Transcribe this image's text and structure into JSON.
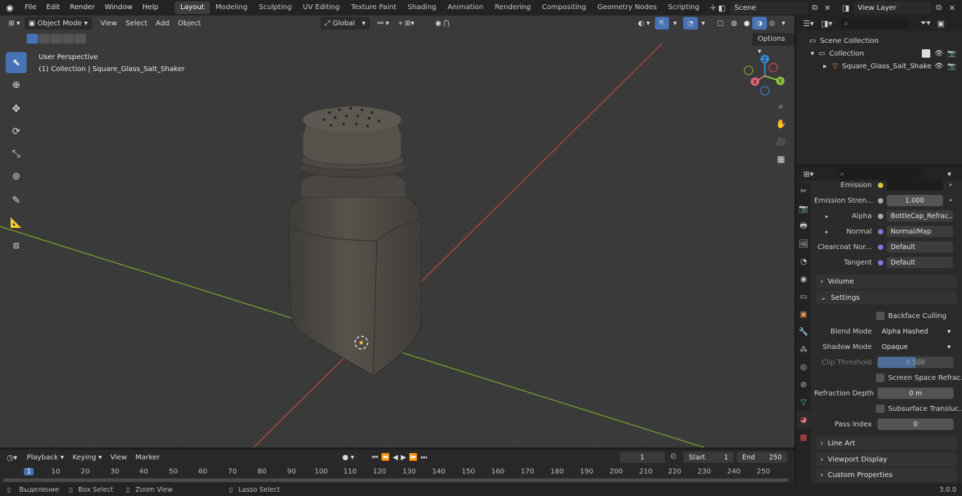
{
  "menu": [
    "File",
    "Edit",
    "Render",
    "Window",
    "Help"
  ],
  "workspaces": [
    "Layout",
    "Modeling",
    "Sculpting",
    "UV Editing",
    "Texture Paint",
    "Shading",
    "Animation",
    "Rendering",
    "Compositing",
    "Geometry Nodes",
    "Scripting"
  ],
  "scene_name": "Scene",
  "view_layer": "View Layer",
  "viewport": {
    "mode": "Object Mode",
    "menus": [
      "View",
      "Select",
      "Add",
      "Object"
    ],
    "transform_orientation": "Global",
    "options_label": "Options",
    "perspective": "User Perspective",
    "collection_info": "(1) Collection | Square_Glass_Salt_Shaker",
    "gizmo": {
      "x": "X",
      "y": "Y",
      "z": "Z"
    }
  },
  "outliner": {
    "scene_collection": "Scene Collection",
    "collection": "Collection",
    "object": "Square_Glass_Salt_Shake"
  },
  "props": {
    "emission_label": "Emission",
    "emission_strength_label": "Emission Stren...",
    "emission_strength_value": "1.000",
    "alpha_label": "Alpha",
    "alpha_value": "BottleCap_Refrac...",
    "normal_label": "Normal",
    "normal_value": "Normal/Map",
    "clearcoat_label": "Clearcoat Nor...",
    "clearcoat_value": "Default",
    "tangent_label": "Tangent",
    "tangent_value": "Default",
    "volume_panel": "Volume",
    "settings_panel": "Settings",
    "backface_culling": "Backface Culling",
    "blend_mode_label": "Blend Mode",
    "blend_mode_value": "Alpha Hashed",
    "shadow_mode_label": "Shadow Mode",
    "shadow_mode_value": "Opaque",
    "clip_threshold_label": "Clip Threshold",
    "clip_threshold_value": "0.500",
    "screen_space_refraction": "Screen Space Refrac...",
    "refraction_depth_label": "Refraction Depth",
    "refraction_depth_value": "0 m",
    "subsurface_translucency": "Subsurface Transluc...",
    "pass_index_label": "Pass Index",
    "pass_index_value": "0",
    "line_art_panel": "Line Art",
    "viewport_display_panel": "Viewport Display",
    "custom_properties_panel": "Custom Properties"
  },
  "timeline": {
    "menus": [
      "Playback",
      "Keying",
      "View",
      "Marker"
    ],
    "current_frame": "1",
    "start_label": "Start",
    "start_value": "1",
    "end_label": "End",
    "end_value": "250",
    "ruler": [
      "1",
      "10",
      "20",
      "30",
      "40",
      "50",
      "60",
      "70",
      "80",
      "90",
      "100",
      "110",
      "120",
      "130",
      "140",
      "150",
      "160",
      "170",
      "180",
      "190",
      "200",
      "210",
      "220",
      "230",
      "240",
      "250"
    ]
  },
  "status": {
    "select": "Выделение",
    "box_select": "Box Select",
    "zoom_view": "Zoom View",
    "lasso_select": "Lasso Select",
    "version": "3.0.0"
  },
  "colors": {
    "accent": "#4772b3",
    "x_axis": "#e06a7a",
    "y_axis": "#8cc43c",
    "z_axis": "#3a8fd8",
    "bg_viewport": "#393939"
  }
}
